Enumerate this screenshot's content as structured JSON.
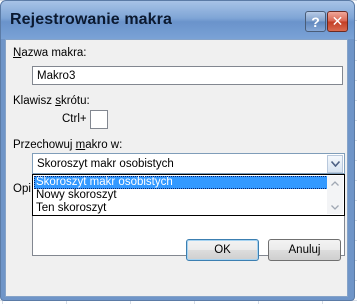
{
  "dialog": {
    "title": "Rejestrowanie makra",
    "help_glyph": "?",
    "close_glyph": "✕"
  },
  "macro_name": {
    "label_key": "N",
    "label_rest": "azwa makra:",
    "value": "Makro3"
  },
  "shortcut": {
    "label_pre": "Klawisz ",
    "label_key": "s",
    "label_rest": "krótu:",
    "prefix": "Ctrl+",
    "value": ""
  },
  "store_in": {
    "label_pre": "Przechowuj ",
    "label_key": "m",
    "label_rest": "akro w:",
    "selected": "Skoroszyt makr osobistych",
    "options": [
      "Skoroszyt makr osobistych",
      "Nowy skoroszyt",
      "Ten skoroszyt"
    ]
  },
  "description": {
    "label_visible": "Opi"
  },
  "buttons": {
    "ok": "OK",
    "cancel": "Anuluj"
  },
  "colors": {
    "selection": "#3399ff",
    "title_bar": "#7fa5d6",
    "close_button": "#c23d24"
  }
}
